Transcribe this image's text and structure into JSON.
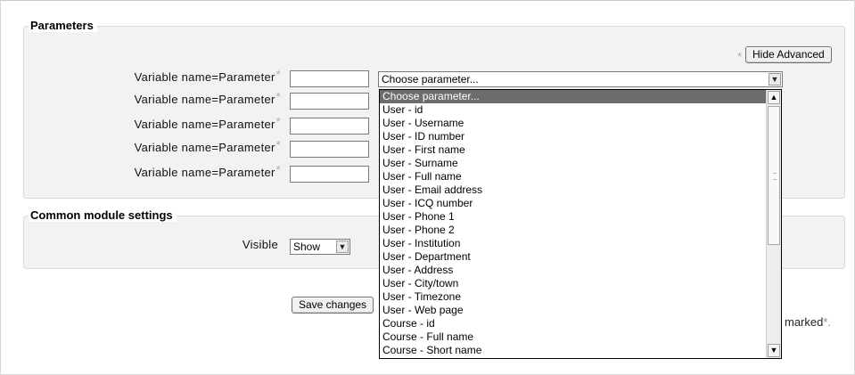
{
  "parameters": {
    "legend": "Parameters",
    "hide_advanced_label": "Hide Advanced",
    "required_mark": "*",
    "rows": [
      {
        "label": "Variable name=Parameter"
      },
      {
        "label": "Variable name=Parameter"
      },
      {
        "label": "Variable name=Parameter"
      },
      {
        "label": "Variable name=Parameter"
      },
      {
        "label": "Variable name=Parameter"
      }
    ],
    "select_value": "Choose parameter...",
    "dropdown_options": [
      "Choose parameter...",
      "User - id",
      "User - Username",
      "User - ID number",
      "User - First name",
      "User - Surname",
      "User - Full name",
      "User - Email address",
      "User - ICQ number",
      "User - Phone 1",
      "User - Phone 2",
      "User - Institution",
      "User - Department",
      "User - Address",
      "User - City/town",
      "User - Timezone",
      "User - Web page",
      "Course - id",
      "Course - Full name",
      "Course - Short name"
    ]
  },
  "common": {
    "legend": "Common module settings",
    "visible_label": "Visible",
    "visible_value": "Show"
  },
  "footer": {
    "save_label": "Save changes",
    "note_text": "marked",
    "note_mark": "*."
  },
  "icons": {
    "dropdown_arrow": "chevron-down-icon",
    "scroll_up": "chevron-up-icon",
    "scroll_down": "chevron-down-icon"
  }
}
